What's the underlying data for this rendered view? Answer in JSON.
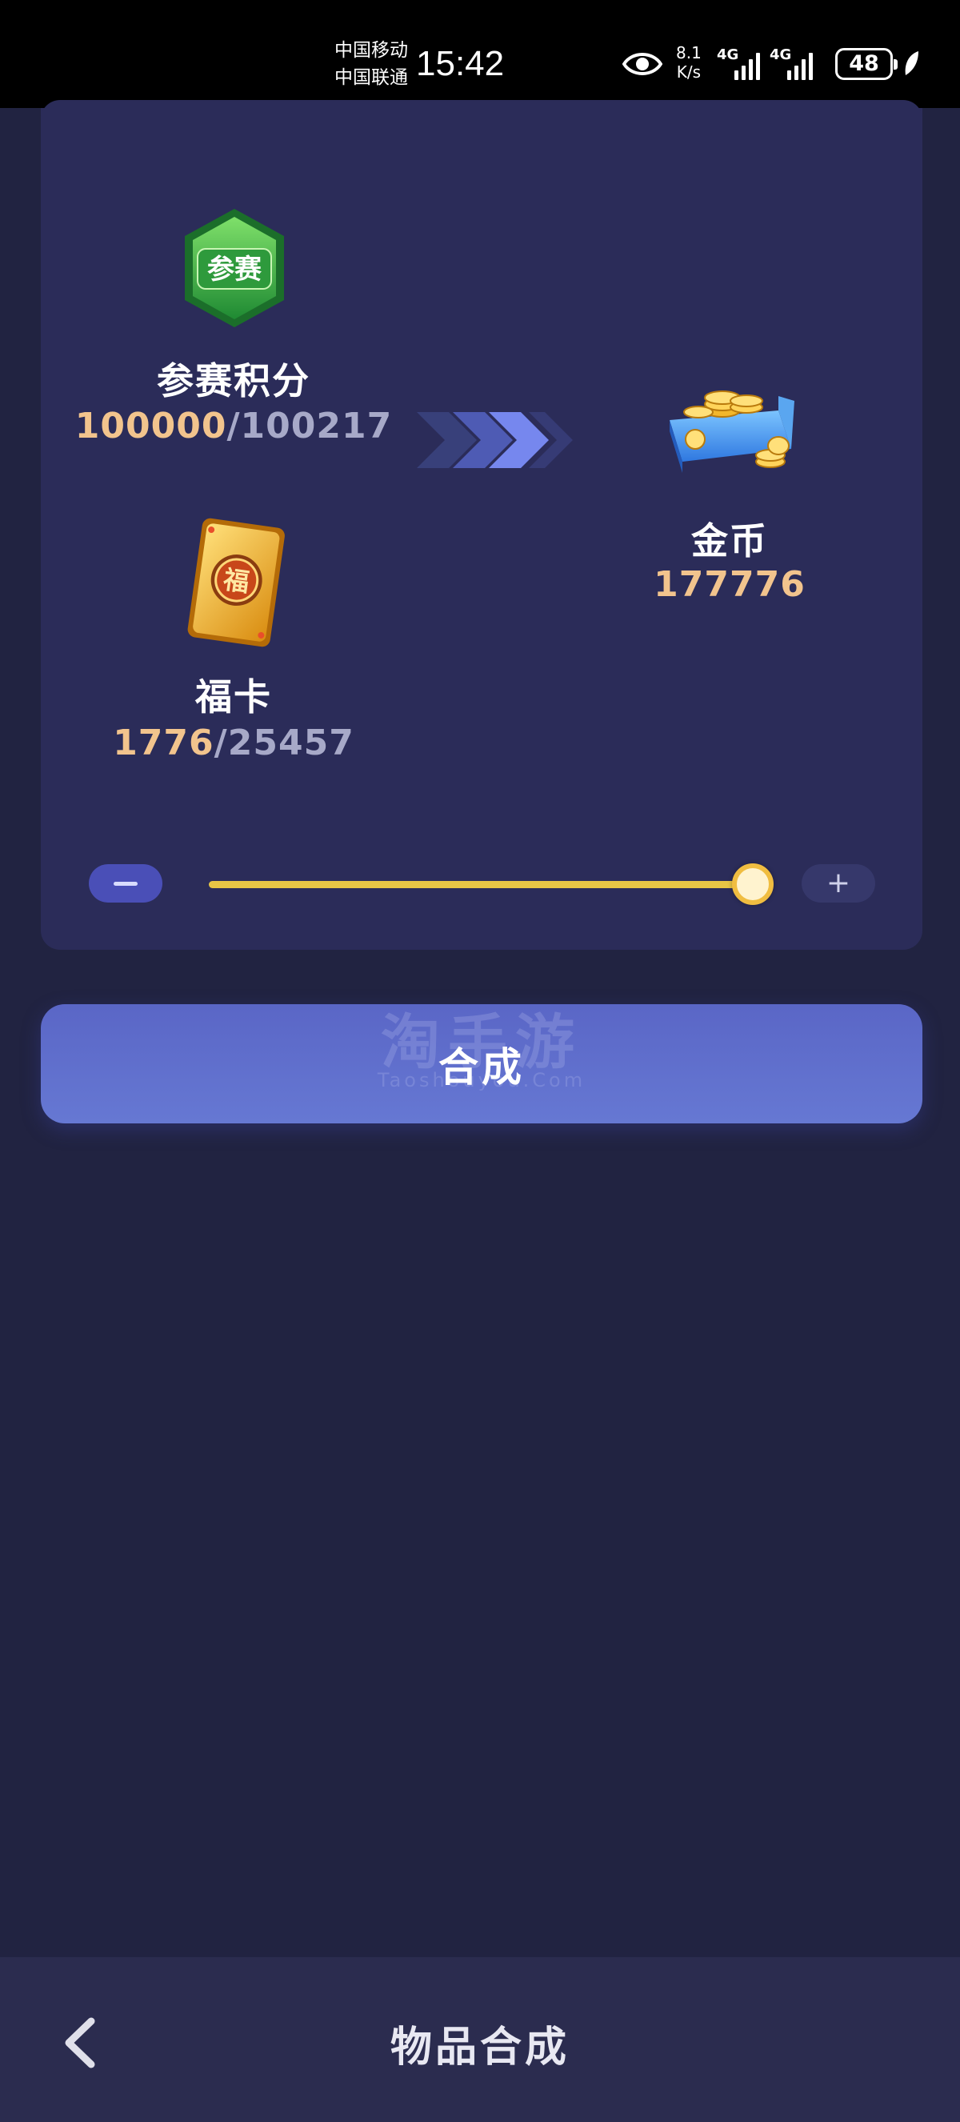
{
  "status_bar": {
    "carrier_1": "中国移动",
    "carrier_2": "中国联通",
    "time": "15:42",
    "net_speed_value": "8.1",
    "net_speed_unit": "K/s",
    "network_1": "4G",
    "network_2": "4G",
    "battery": "48"
  },
  "inputs": [
    {
      "name": "参赛积分",
      "have": "100000",
      "separator": "/",
      "total": "100217",
      "icon": "competition-badge-icon",
      "icon_text": "参赛"
    },
    {
      "name": "福卡",
      "have": "1776",
      "separator": "/",
      "total": "25457",
      "icon": "fortune-card-icon",
      "icon_text": "福"
    }
  ],
  "output": {
    "name": "金币",
    "amount": "177776",
    "icon": "gold-coin-box-icon"
  },
  "slider": {
    "level": 1.0
  },
  "synth_button": {
    "label": "合成"
  },
  "watermark": {
    "cn": "淘手游",
    "en": "Taoshouyou.Com"
  },
  "nav": {
    "title": "物品合成"
  },
  "colors": {
    "accent": "#f2c48d",
    "button": "#6070cc",
    "slider": "#e8c545"
  }
}
